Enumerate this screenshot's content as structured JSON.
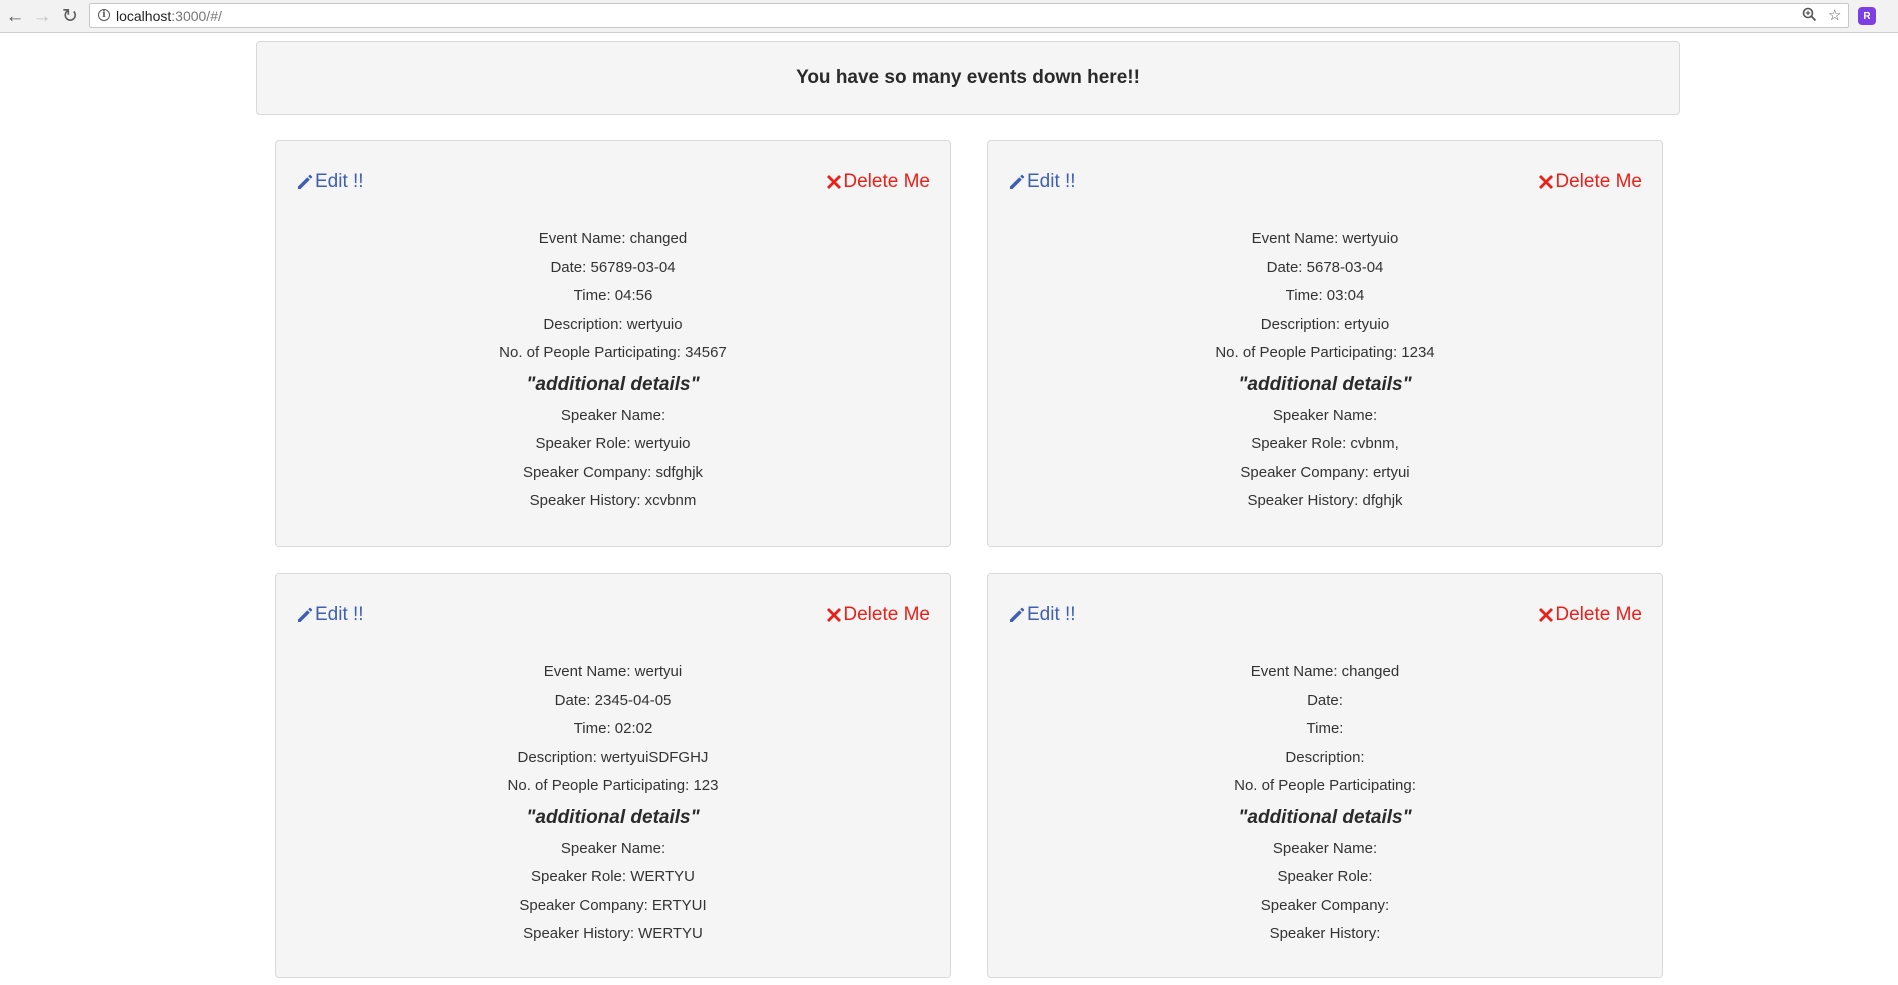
{
  "browser": {
    "url_host": "localhost",
    "url_rest": ":3000/#/"
  },
  "banner": {
    "title": "You have so many events down here!!"
  },
  "labels": {
    "edit": "Edit !!",
    "delete": "Delete Me",
    "additional": "\"additional details\""
  },
  "events": [
    {
      "event_name": "Event Name: changed",
      "date": "Date: 56789-03-04",
      "time": "Time: 04:56",
      "description": "Description: wertyuio",
      "participants": "No. of People Participating: 34567",
      "speaker_name": "Speaker Name:",
      "speaker_role": "Speaker Role: wertyuio",
      "speaker_company": "Speaker Company: sdfghjk",
      "speaker_history": "Speaker History: xcvbnm"
    },
    {
      "event_name": "Event Name: wertyuio",
      "date": "Date: 5678-03-04",
      "time": "Time: 03:04",
      "description": "Description: ertyuio",
      "participants": "No. of People Participating: 1234",
      "speaker_name": "Speaker Name:",
      "speaker_role": "Speaker Role: cvbnm,",
      "speaker_company": "Speaker Company: ertyui",
      "speaker_history": "Speaker History: dfghjk"
    },
    {
      "event_name": "Event Name: wertyui",
      "date": "Date: 2345-04-05",
      "time": "Time: 02:02",
      "description": "Description: wertyuiSDFGHJ",
      "participants": "No. of People Participating: 123",
      "speaker_name": "Speaker Name:",
      "speaker_role": "Speaker Role: WERTYU",
      "speaker_company": "Speaker Company: ERTYUI",
      "speaker_history": "Speaker History: WERTYU"
    },
    {
      "event_name": "Event Name: changed",
      "date": "Date:",
      "time": "Time:",
      "description": "Description:",
      "participants": "No. of People Participating:",
      "speaker_name": "Speaker Name:",
      "speaker_role": "Speaker Role:",
      "speaker_company": "Speaker Company:",
      "speaker_history": "Speaker History:"
    }
  ],
  "colors": {
    "edit": "#3f5fb0",
    "delete": "#e8201a",
    "card_bg": "#f5f5f5"
  }
}
